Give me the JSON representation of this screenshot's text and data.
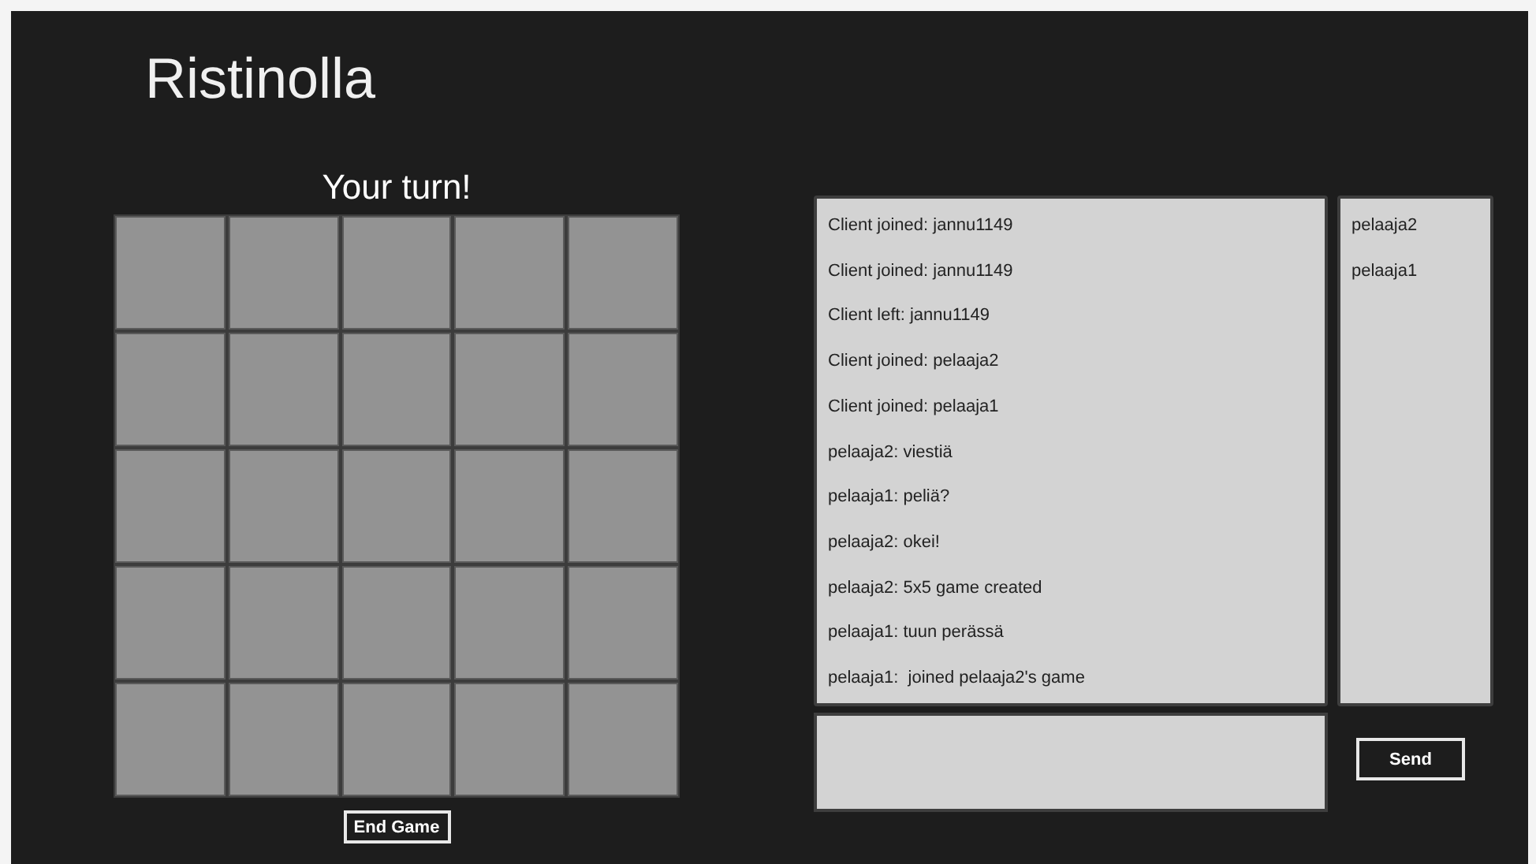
{
  "app_title": "Ristinolla",
  "turn_status": "Your turn!",
  "board": {
    "rows": [
      [
        {
          "kind": "empty"
        },
        {
          "kind": "empty"
        },
        {
          "kind": "empty"
        },
        {
          "kind": "empty"
        },
        {
          "kind": "empty"
        }
      ],
      [
        {
          "kind": "empty"
        },
        {
          "kind": "empty"
        },
        {
          "kind": "empty"
        },
        {
          "kind": "empty"
        },
        {
          "kind": "empty"
        }
      ],
      [
        {
          "kind": "empty"
        },
        {
          "kind": "empty"
        },
        {
          "kind": "empty"
        },
        {
          "kind": "empty"
        },
        {
          "kind": "empty"
        }
      ],
      [
        {
          "kind": "empty"
        },
        {
          "kind": "empty"
        },
        {
          "kind": "empty"
        },
        {
          "kind": "empty"
        },
        {
          "kind": "empty"
        }
      ],
      [
        {
          "kind": "empty"
        },
        {
          "kind": "empty"
        },
        {
          "kind": "empty"
        },
        {
          "kind": "empty"
        },
        {
          "kind": "empty"
        }
      ]
    ]
  },
  "end_game_button": "End Game",
  "chat_log": [
    "Client joined: jannu1149",
    "Client joined: jannu1149",
    "Client left: jannu1149",
    "Client joined: pelaaja2",
    "Client joined: pelaaja1",
    "pelaaja2: viestiä",
    "pelaaja1: peliä?",
    "pelaaja2: okei!",
    "pelaaja2: 5x5 game created",
    "pelaaja1: tuun perässä",
    "pelaaja1:  joined pelaaja2's game"
  ],
  "users": [
    "pelaaja2",
    "pelaaja1"
  ],
  "send_button": "Send"
}
